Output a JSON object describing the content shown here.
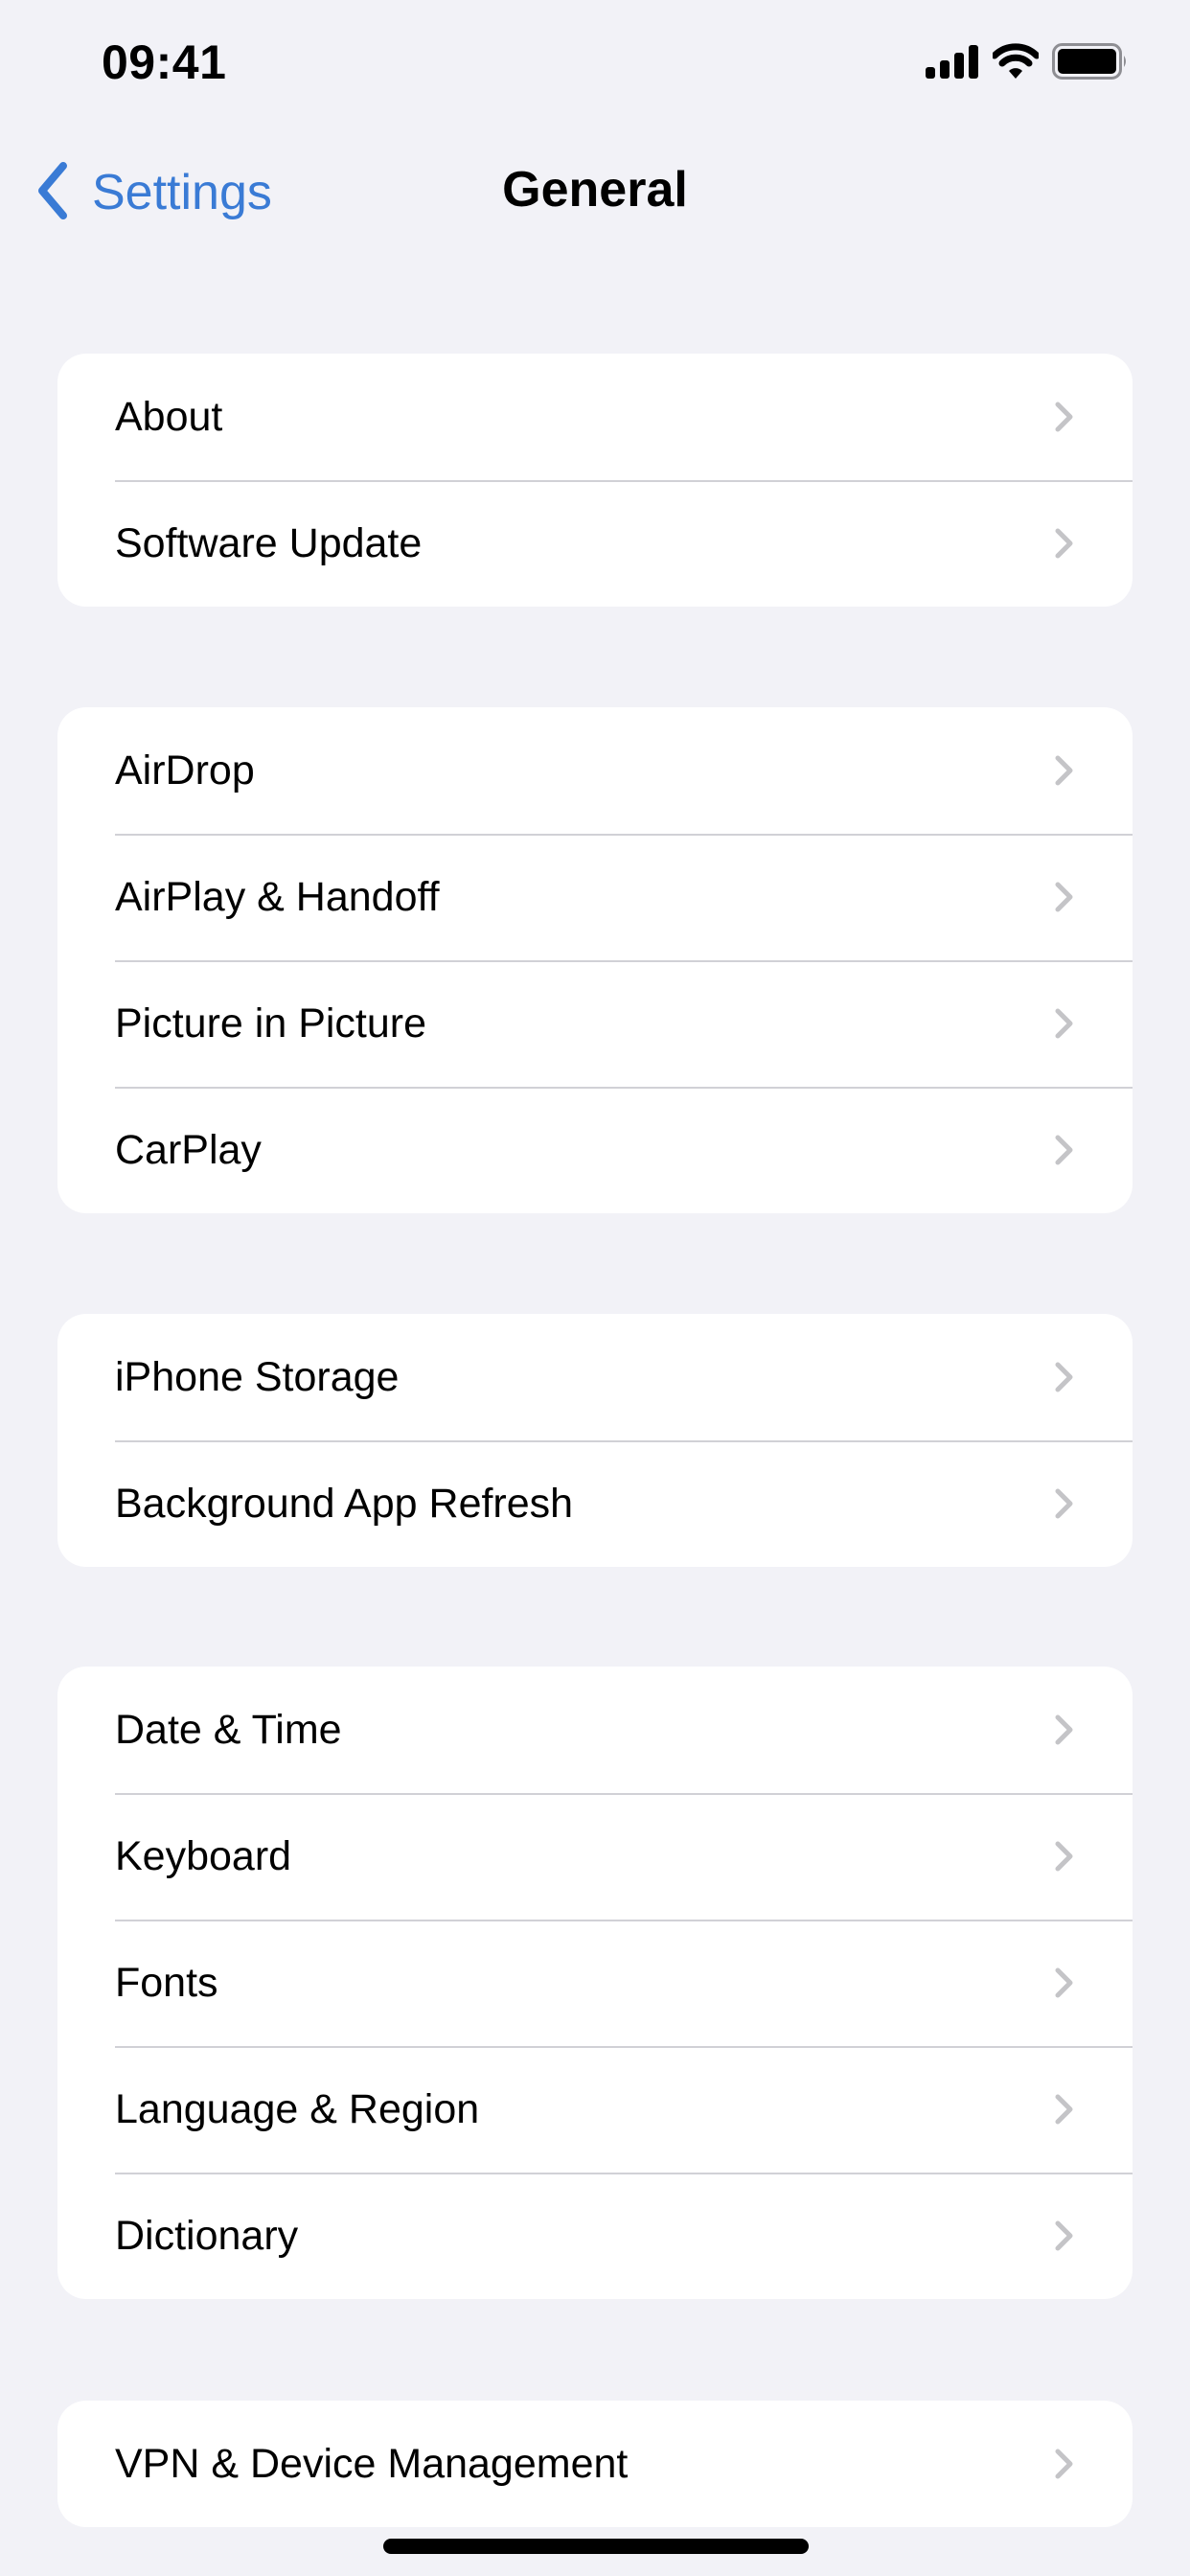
{
  "status_bar": {
    "time": "09:41",
    "icons": [
      "cellular-signal-icon",
      "wifi-icon",
      "battery-icon"
    ]
  },
  "nav": {
    "back_label": "Settings",
    "back_icon": "chevron-left-icon",
    "title": "General"
  },
  "colors": {
    "accent": "#3A7BD5",
    "background": "#F2F2F7",
    "card": "#FFFFFF",
    "separator": "#D1D1D6",
    "chevron": "#C4C4C7"
  },
  "groups": [
    {
      "items": [
        {
          "label": "About"
        },
        {
          "label": "Software Update"
        }
      ]
    },
    {
      "items": [
        {
          "label": "AirDrop"
        },
        {
          "label": "AirPlay & Handoff"
        },
        {
          "label": "Picture in Picture"
        },
        {
          "label": "CarPlay"
        }
      ]
    },
    {
      "items": [
        {
          "label": "iPhone Storage"
        },
        {
          "label": "Background App Refresh"
        }
      ]
    },
    {
      "items": [
        {
          "label": "Date & Time"
        },
        {
          "label": "Keyboard"
        },
        {
          "label": "Fonts"
        },
        {
          "label": "Language & Region"
        },
        {
          "label": "Dictionary"
        }
      ]
    },
    {
      "items": [
        {
          "label": "VPN & Device Management"
        }
      ]
    }
  ]
}
